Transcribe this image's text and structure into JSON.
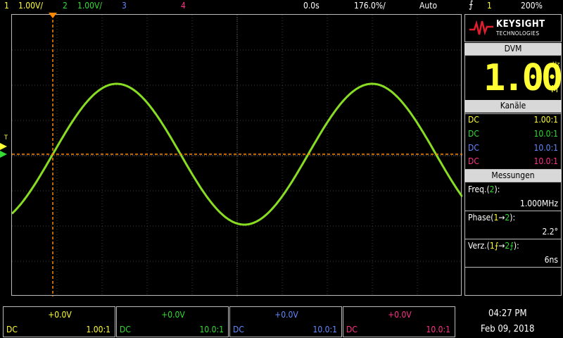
{
  "topbar": {
    "ch1_num": "1",
    "ch1_scale": "1.00V/",
    "ch2_num": "2",
    "ch2_scale": "1.00V/",
    "ch3_num": "3",
    "ch4_num": "4",
    "time_delay": "0.0s",
    "time_scale": "176.0%/",
    "trigger_mode": "Auto",
    "trigger_icon": "trigger-edge-icon",
    "trigger_source": "1",
    "trigger_level": "200%"
  },
  "brand": {
    "name": "KEYSIGHT",
    "sub": "TECHNOLOGIES"
  },
  "dvm": {
    "title": "DVM",
    "value": "1.00",
    "unit_hz": "Hz",
    "unit_m": "M"
  },
  "channels_panel": {
    "title": "Kanäle",
    "rows": [
      {
        "coupling": "DC",
        "probe": "1.00:1",
        "color": "#ffff33"
      },
      {
        "coupling": "DC",
        "probe": "10.0:1",
        "color": "#33dd33"
      },
      {
        "coupling": "DC",
        "probe": "10.0:1",
        "color": "#6688ff"
      },
      {
        "coupling": "DC",
        "probe": "10.0:1",
        "color": "#ff3388"
      }
    ]
  },
  "measurements": {
    "title": "Messungen",
    "freq_label": "Freq.(",
    "freq_ch": "2",
    "freq_end": "):",
    "freq_value": "1.000MHz",
    "phase_label": "Phase(",
    "phase_ch1": "1",
    "phase_arrow": "→",
    "phase_ch2": "2",
    "phase_end": "):",
    "phase_value": "2.2°",
    "delay_label": "Verz.(",
    "delay_ch1": "1⨍",
    "delay_arrow": "→",
    "delay_ch2": "2⨍",
    "delay_end": "):",
    "delay_value": "6ns"
  },
  "bottom_channels": [
    {
      "offset": "+0.0V",
      "coupling": "DC",
      "probe": "1.00:1",
      "color": "#ffff33"
    },
    {
      "offset": "+0.0V",
      "coupling": "DC",
      "probe": "10.0:1",
      "color": "#33dd33"
    },
    {
      "offset": "+0.0V",
      "coupling": "DC",
      "probe": "10.0:1",
      "color": "#6688ff"
    },
    {
      "offset": "+0.0V",
      "coupling": "DC",
      "probe": "10.0:1",
      "color": "#ff3388"
    }
  ],
  "clock": {
    "time": "04:27 PM",
    "date": "Feb 09, 2018"
  },
  "trace": {
    "color": "#88dd22",
    "cursor_color": "#ff8800",
    "trigger_marker_label": "T"
  },
  "colors": {
    "ch1": "#ffff33",
    "ch2": "#33dd33",
    "ch3": "#6688ff",
    "ch4": "#ff3388"
  }
}
